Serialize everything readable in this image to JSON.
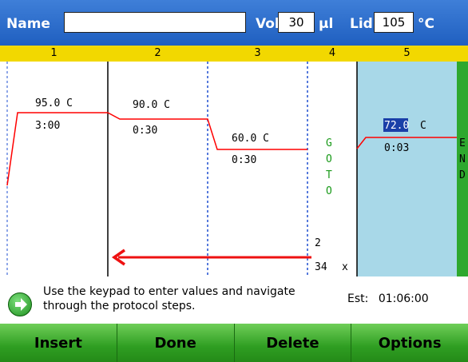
{
  "header": {
    "name_label": "Name",
    "name_value": "",
    "vol_label": "Vol",
    "vol_value": "30",
    "vol_unit": "µl",
    "lid_label": "Lid",
    "lid_value": "105",
    "lid_unit": "°C"
  },
  "steps": [
    {
      "number": "1",
      "temp": "95.0 C",
      "time": "3:00"
    },
    {
      "number": "2",
      "temp": "90.0 C",
      "time": "0:30"
    },
    {
      "number": "3",
      "temp": "60.0 C",
      "time": "0:30"
    },
    {
      "number": "4",
      "goto_letters": [
        "G",
        "O",
        "T",
        "O"
      ],
      "goto_step": "2",
      "goto_count": "34",
      "goto_x": "x"
    },
    {
      "number": "5",
      "temp_value": "72.0",
      "temp_unit": "C",
      "time": "0:03"
    }
  ],
  "end_letters": [
    "E",
    "N",
    "D"
  ],
  "message": "Use the keypad to enter values and navigate through the protocol steps.",
  "estimate": {
    "label": "Est:",
    "value": "01:06:00"
  },
  "footer": {
    "insert": "Insert",
    "done": "Done",
    "delete": "Delete",
    "options": "Options"
  },
  "colors": {
    "header": "#2a6cd0",
    "step_strip": "#f2d800",
    "selected_step": "#a8d8e8",
    "curve": "#ff0000",
    "footer": "#2f9e22",
    "goto_text": "#1a9a1a"
  }
}
